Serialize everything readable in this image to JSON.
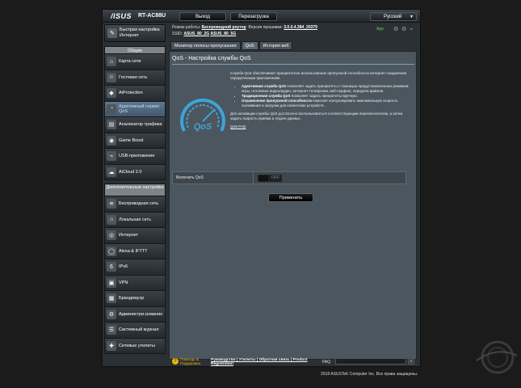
{
  "header": {
    "logo": "/ISUS",
    "model": "RT-AC88U",
    "logout_label": "Выход",
    "reboot_label": "Перезагрузка",
    "language": "Русский"
  },
  "status": {
    "mode_label": "Режим работы:",
    "mode_value": "Беспроводной роутер",
    "firmware_label": "Версия прошивки:",
    "firmware_value": "3.0.0.4.384_20379",
    "ssid_label": "SSID:",
    "ssid_1": "ASUS_80_2G",
    "ssid_2": "ASUS_80_5G",
    "app_label": "App"
  },
  "sidebar": {
    "quick_setup": "Быстрая настройка Интернет",
    "general_header": "Общие",
    "general_items": [
      {
        "label": "Карта сети",
        "icon": "network-map"
      },
      {
        "label": "Гостевая сеть",
        "icon": "guest-network"
      },
      {
        "label": "AiProtection",
        "icon": "shield"
      },
      {
        "label": "Адаптивный сервис QoS",
        "icon": "qos-gauge"
      },
      {
        "label": "Анализатор трафика",
        "icon": "traffic"
      },
      {
        "label": "Game Boost",
        "icon": "gamepad"
      },
      {
        "label": "USB-приложение",
        "icon": "usb"
      },
      {
        "label": "AiCloud 2.0",
        "icon": "cloud"
      }
    ],
    "advanced_header": "Дополнительные настройки",
    "advanced_items": [
      {
        "label": "Беспроводная сеть",
        "icon": "wifi"
      },
      {
        "label": "Локальная сеть",
        "icon": "lan"
      },
      {
        "label": "Интернет",
        "icon": "globe"
      },
      {
        "label": "Alexa & IFTTT",
        "icon": "alexa"
      },
      {
        "label": "IPv6",
        "icon": "ipv6"
      },
      {
        "label": "VPN",
        "icon": "vpn"
      },
      {
        "label": "Брандмауэр",
        "icon": "firewall"
      },
      {
        "label": "Администри-рование",
        "icon": "admin"
      },
      {
        "label": "Системный журнал",
        "icon": "log"
      },
      {
        "label": "Сетевые утилиты",
        "icon": "tools"
      }
    ]
  },
  "tabs": [
    "Монитор полосы пропускания",
    "QoS",
    "История веб"
  ],
  "active_tab": "QoS",
  "page": {
    "title": "QoS - Настройка службы QoS",
    "intro": "Служба QoS обеспечивает приоритетное использование пропускной способности интернет-соединения определенным приложениям.",
    "bullets": [
      {
        "bold": "Адаптивная служба QoS",
        "text": " позволяет задать приоритеты с помощью предустановленных режимов: игры, потоковое видео/аудио, интернет-телефония, веб-серфинг, передача файлов."
      },
      {
        "bold": "Традиционная служба QoS",
        "text": " позволяет задать приоритеты вручную."
      },
      {
        "bold": "Ограничение пропускной способности",
        "text": " помогает контролировать максимальную скорость скачивания и загрузки для клиентских устройств."
      }
    ],
    "activation_note": "Для активации службы QoS достаточно воспользоваться соответствующим переключателем, а затем задать скорость приема и отдачи данных.",
    "faq_link": "QoS FAQ",
    "gauge_text": "QoS",
    "enable_label": "Включить QoS",
    "toggle_state": "OFF",
    "apply_label": "Применить"
  },
  "footer": {
    "help_line1": "Помощь &",
    "help_line2": "Поддержка",
    "links_line1": "Руководство | Утилиты | Обратная связь | Product",
    "links_line2": "Registration",
    "faq_label": "FAQ",
    "copyright": "2018 ASUSTeK Computer Inc. Все права защищены."
  },
  "colors": {
    "accent": "#5f7891",
    "panel": "#4b565e",
    "qos_blue": "#3fa3d8"
  }
}
